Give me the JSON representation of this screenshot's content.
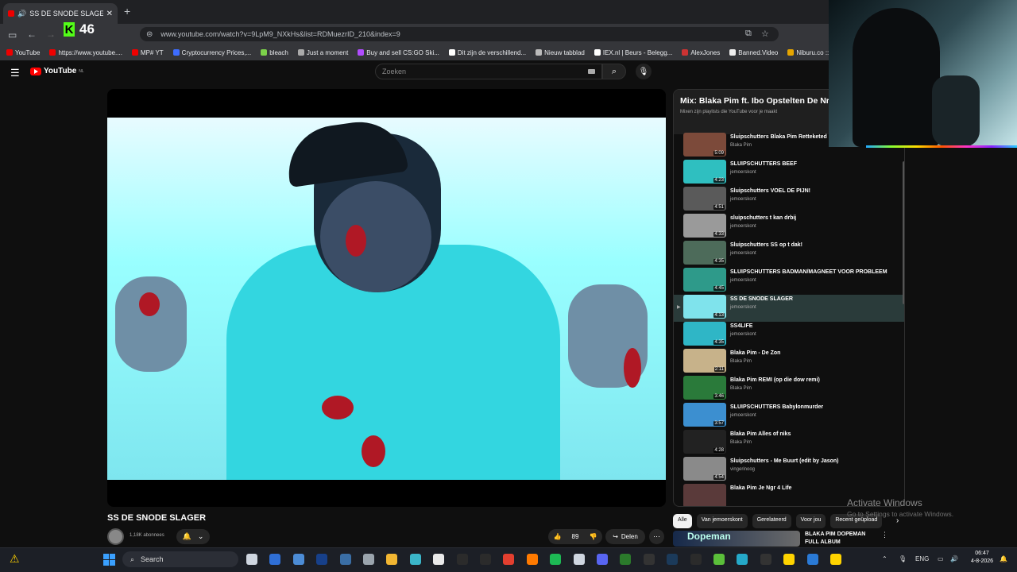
{
  "browser": {
    "tab_title": "SS DE SNODE SLAGER - YouTube",
    "new_tab": "+",
    "url": "www.youtube.com/watch?v=9LpM9_NXkHs&list=RDMuezrID_210&index=9",
    "kick_badge_letter": "K",
    "kick_badge_count": "46",
    "bookmarks": [
      {
        "label": "YouTube",
        "color": "#e00"
      },
      {
        "label": "https://www.youtube....",
        "color": "#e00"
      },
      {
        "label": "MP# YT",
        "color": "#e00"
      },
      {
        "label": "Cryptocurrency Prices,...",
        "color": "#3d6cff"
      },
      {
        "label": "bleach",
        "color": "#7cd14a"
      },
      {
        "label": "Just a moment",
        "color": "#aaa"
      },
      {
        "label": "Buy and sell CS:GO Ski...",
        "color": "#b14cff"
      },
      {
        "label": "Dit zijn de verschillend...",
        "color": "#fff"
      },
      {
        "label": "Nieuw tabblad",
        "color": "#bbb"
      },
      {
        "label": "IEX.nl | Beurs - Belegg...",
        "color": "#fff"
      },
      {
        "label": "AlexJones",
        "color": "#c33"
      },
      {
        "label": "Banned.Video",
        "color": "#eee"
      },
      {
        "label": "Niburu.co :: Onthulle",
        "color": "#e6a500"
      }
    ]
  },
  "youtube": {
    "logo_text": "YouTube",
    "logo_region": "NL",
    "search_placeholder": "Zoeken",
    "video_title": "SS DE SNODE SLAGER",
    "subscribers": "1,18K abonnees",
    "like_count": "89",
    "share_label": "Delen",
    "playlist_title": "Mix: Blaka Pim ft. Ibo Opstelten De Nr.1",
    "playlist_subtitle": "Mixen zijn playlists die YouTube voor je maakt",
    "playlist": [
      {
        "title": "Sluipschutters Blaka Pim Retteketed \"Van de straat\"",
        "channel": "Blaka Pim",
        "duration": "5:09",
        "thumb": "#7c4a3a"
      },
      {
        "title": "SLUIPSCHUTTERS BEEF",
        "channel": "jemoerskont",
        "duration": "4:23",
        "thumb": "#2fbfc0"
      },
      {
        "title": "Sluipschutters VOEL DE PIJN!",
        "channel": "jemoerskont",
        "duration": "4:51",
        "thumb": "#5a5a5a"
      },
      {
        "title": "sluipschutters t kan drbij",
        "channel": "jemoerskont",
        "duration": "4:33",
        "thumb": "#9a9a9a"
      },
      {
        "title": "Sluipschutters SS op t dak!",
        "channel": "jemoerskont",
        "duration": "4:35",
        "thumb": "#4d6b5a"
      },
      {
        "title": "SLUIPSCHUTTERS BADMAN/MAGNEET VOOR PROBLEEM",
        "channel": "jemoerskont",
        "duration": "4:45",
        "thumb": "#2e9a8a"
      },
      {
        "title": "SS DE SNODE SLAGER",
        "channel": "jemoerskont",
        "duration": "4:13",
        "thumb": "#7fe3ec",
        "active": true
      },
      {
        "title": "SS4LIFE",
        "channel": "jemoerskont",
        "duration": "4:35",
        "thumb": "#2fb6c6"
      },
      {
        "title": "Blaka Pim - De Zon",
        "channel": "Blaka Pim",
        "duration": "2:11",
        "thumb": "#c7b28a"
      },
      {
        "title": "Blaka Pim REMI (op die dow remi)",
        "channel": "Blaka Pim",
        "duration": "3:46",
        "thumb": "#2a7a3a"
      },
      {
        "title": "SLUIPSCHUTTERS Babylonmurder",
        "channel": "jemoerskont",
        "duration": "3:57",
        "thumb": "#3c8fd0"
      },
      {
        "title": "Blaka Pim Alles of niks",
        "channel": "Blaka Pim",
        "duration": "4:28",
        "thumb": "#222"
      },
      {
        "title": "Sluipschutters - Me Buurt (edit by Jason)",
        "channel": "vingerinoog",
        "duration": "4:54",
        "thumb": "#8a8a8a"
      },
      {
        "title": "Blaka Pim Je Ngr 4 Life",
        "channel": "",
        "duration": "",
        "thumb": "#5a3a3a"
      }
    ],
    "chips": [
      "Alle",
      "Van jemoerskont",
      "Gerelateerd",
      "Voor jou",
      "Recent geüpload"
    ],
    "recommendation": {
      "thumb_text": "Dopeman",
      "title": "BLAKA PIM DOPEMAN FULL ALBUM"
    }
  },
  "windows": {
    "watermark_title": "Activate Windows",
    "watermark_sub": "Go to Settings to activate Windows.",
    "search_label": "Search",
    "language": "ENG",
    "time": "06:47",
    "date": "4-8-2026",
    "taskbar_apps": [
      "#cfd6e0",
      "#2f6fd6",
      "#4c8cd6",
      "#17408a",
      "#3a6ea5",
      "#9aa4ad",
      "#f2b632",
      "#3bb6c9",
      "#e9e9e9",
      "#2b2b2b",
      "#2b2b2b",
      "#e33f2f",
      "#ff7a00",
      "#1db954",
      "#cfd6e0",
      "#5865f2",
      "#2b7a2b",
      "#333",
      "#1b3a5a",
      "#2b2b2b",
      "#5bbf3a",
      "#25a9c9",
      "#333",
      "#ffd400",
      "#2a7ad6",
      "#ffd400"
    ]
  }
}
